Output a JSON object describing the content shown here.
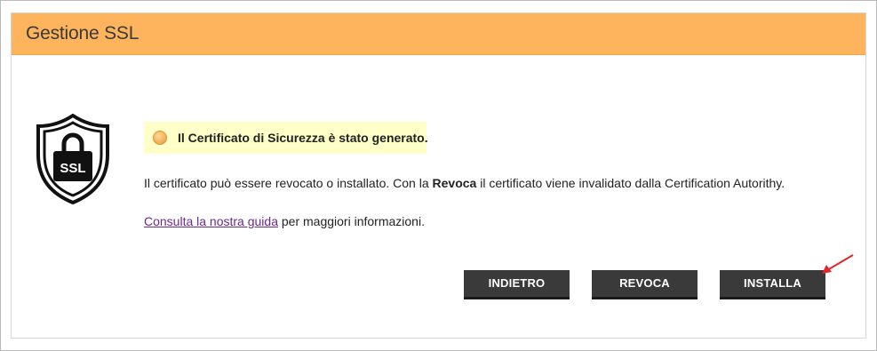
{
  "header": {
    "title": "Gestione SSL"
  },
  "logo": {
    "text": "SSL",
    "icon": "ssl-shield-lock-icon"
  },
  "notice": {
    "text": "Il Certificato di Sicurezza è stato generato.",
    "icon": "status-dot-icon",
    "color": "#ffffc8"
  },
  "description": {
    "part1": "Il certificato può essere revocato o installato. Con la ",
    "bold": "Revoca",
    "part2": " il certificato viene invalidato dalla Certification Autorithy."
  },
  "guide": {
    "link": "Consulta la nostra guida",
    "rest": " per maggiori informazioni."
  },
  "buttons": {
    "back": "INDIETRO",
    "revoke": "REVOCA",
    "install": "INSTALLA"
  },
  "colors": {
    "header": "#fdb45c",
    "button": "#3a3a3a",
    "arrow": "#e3262b"
  }
}
